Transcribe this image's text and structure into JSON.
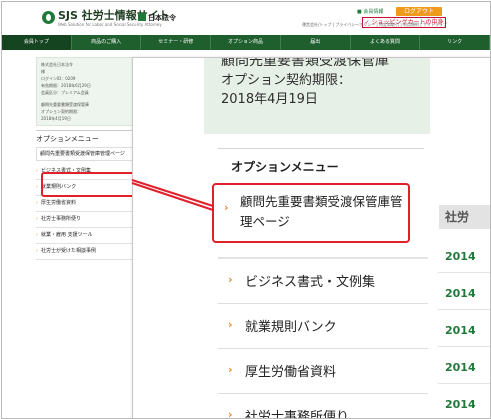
{
  "header": {
    "logo_title": "SJS 社労士情報サイト",
    "logo_sub": "Web Solution for Labor and Social Security Attorney",
    "logo_sub2": "",
    "partner": "日本法令",
    "member_info": "会員情報",
    "login_label": "ログアウト",
    "cart_label": "ショッピングカートの中身",
    "utility_links": "運営会社/トップ | プライバシーポリシー | 特定商取引 | 利用規約 | サイトマップ"
  },
  "nav": {
    "items": [
      "会員トップ",
      "商品のご購入",
      "セミナー・研修",
      "オプション商品",
      "届出",
      "よくある質問",
      "リンク"
    ]
  },
  "sidebar": {
    "account_lines": [
      "株式会社日本法令",
      "様",
      "ログインID：0209",
      "有効期限：2018年6月29日",
      "会員区分：プレミアム会員"
    ],
    "option_lines": [
      "顧問先重要書類受渡保管庫",
      "オプション契約期限：",
      "2018年4月19日"
    ],
    "option_menu_title": "オプションメニュー",
    "option_menu_first": "顧問先重要書類受渡保管庫管理ページ",
    "items": [
      "ビジネス書式・文例集",
      "就業規則バンク",
      "厚生労働省資料",
      "社労士事務所便り",
      "就業・雇用 支援ツール",
      "社労士が受けた相談事例"
    ]
  },
  "zoom": {
    "line1": "顧問先重要書類受渡保管庫",
    "line2": "オプション契約期限：",
    "line3": "2018年4月19日",
    "option_menu_title": "オプションメニュー",
    "highlight_label": "顧問先重要書類受渡保管庫管理ページ",
    "items": [
      "ビジネス書式・文例集",
      "就業規則バンク",
      "厚生労働省資料",
      "社労士事務所便り"
    ]
  },
  "right": {
    "heading": "社労",
    "years": [
      "2014",
      "2014",
      "2014",
      "2014",
      "2014"
    ]
  },
  "colors": {
    "accent_green": "#1f5f2e",
    "highlight_red": "#e0202a",
    "chevron_orange": "#e58a2a"
  }
}
